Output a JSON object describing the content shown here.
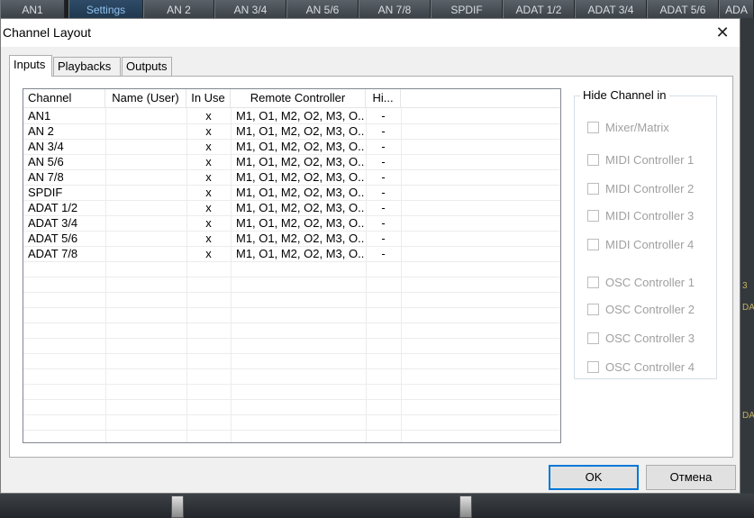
{
  "background": {
    "tabs": [
      {
        "label": "AN1",
        "active": false
      },
      {
        "label": "Settings",
        "active": true
      },
      {
        "label": "AN 2",
        "active": false
      },
      {
        "label": "AN 3/4",
        "active": false
      },
      {
        "label": "AN 5/6",
        "active": false
      },
      {
        "label": "AN 7/8",
        "active": false
      },
      {
        "label": "SPDIF",
        "active": false
      },
      {
        "label": "ADAT 1/2",
        "active": false
      },
      {
        "label": "ADAT 3/4",
        "active": false
      },
      {
        "label": "ADAT 5/6",
        "active": false
      },
      {
        "label": "ADA",
        "active": false
      }
    ],
    "right_marks": [
      "3",
      "DAT",
      "DAT"
    ]
  },
  "dialog": {
    "title": "Channel Layout",
    "close_symbol": "✕",
    "tabs": [
      {
        "label": "Inputs",
        "selected": true
      },
      {
        "label": "Playbacks",
        "selected": false
      },
      {
        "label": "Outputs",
        "selected": false
      }
    ],
    "table": {
      "columns": [
        "Channel",
        "Name (User)",
        "In Use",
        "Remote Controller",
        "Hi..."
      ],
      "rows": [
        {
          "channel": "AN1",
          "name": "",
          "in_use": "x",
          "remote": "M1, O1, M2, O2, M3, O...",
          "hide": "-"
        },
        {
          "channel": "AN 2",
          "name": "",
          "in_use": "x",
          "remote": "M1, O1, M2, O2, M3, O...",
          "hide": "-"
        },
        {
          "channel": "AN 3/4",
          "name": "",
          "in_use": "x",
          "remote": "M1, O1, M2, O2, M3, O...",
          "hide": "-"
        },
        {
          "channel": "AN 5/6",
          "name": "",
          "in_use": "x",
          "remote": "M1, O1, M2, O2, M3, O...",
          "hide": "-"
        },
        {
          "channel": "AN 7/8",
          "name": "",
          "in_use": "x",
          "remote": "M1, O1, M2, O2, M3, O...",
          "hide": "-"
        },
        {
          "channel": "SPDIF",
          "name": "",
          "in_use": "x",
          "remote": "M1, O1, M2, O2, M3, O...",
          "hide": "-"
        },
        {
          "channel": "ADAT 1/2",
          "name": "",
          "in_use": "x",
          "remote": "M1, O1, M2, O2, M3, O...",
          "hide": "-"
        },
        {
          "channel": "ADAT 3/4",
          "name": "",
          "in_use": "x",
          "remote": "M1, O1, M2, O2, M3, O...",
          "hide": "-"
        },
        {
          "channel": "ADAT 5/6",
          "name": "",
          "in_use": "x",
          "remote": "M1, O1, M2, O2, M3, O...",
          "hide": "-"
        },
        {
          "channel": "ADAT 7/8",
          "name": "",
          "in_use": "x",
          "remote": "M1, O1, M2, O2, M3, O...",
          "hide": "-"
        }
      ]
    },
    "hide_group": {
      "title": "Hide Channel in",
      "options": [
        {
          "label": "Mixer/Matrix",
          "checked": false,
          "enabled": false
        },
        {
          "label": "MIDI Controller 1",
          "checked": false,
          "enabled": false
        },
        {
          "label": "MIDI Controller 2",
          "checked": false,
          "enabled": false
        },
        {
          "label": "MIDI Controller 3",
          "checked": false,
          "enabled": false
        },
        {
          "label": "MIDI Controller 4",
          "checked": false,
          "enabled": false
        },
        {
          "label": "OSC Controller 1",
          "checked": false,
          "enabled": false
        },
        {
          "label": "OSC Controller 2",
          "checked": false,
          "enabled": false
        },
        {
          "label": "OSC Controller 3",
          "checked": false,
          "enabled": false
        },
        {
          "label": "OSC Controller 4",
          "checked": false,
          "enabled": false
        }
      ]
    },
    "buttons": {
      "ok": "OK",
      "cancel": "Отмена"
    }
  },
  "colors": {
    "accent": "#0078d7",
    "active_tab_text": "#8fc0ee",
    "disabled_text": "#a0a0a0"
  }
}
